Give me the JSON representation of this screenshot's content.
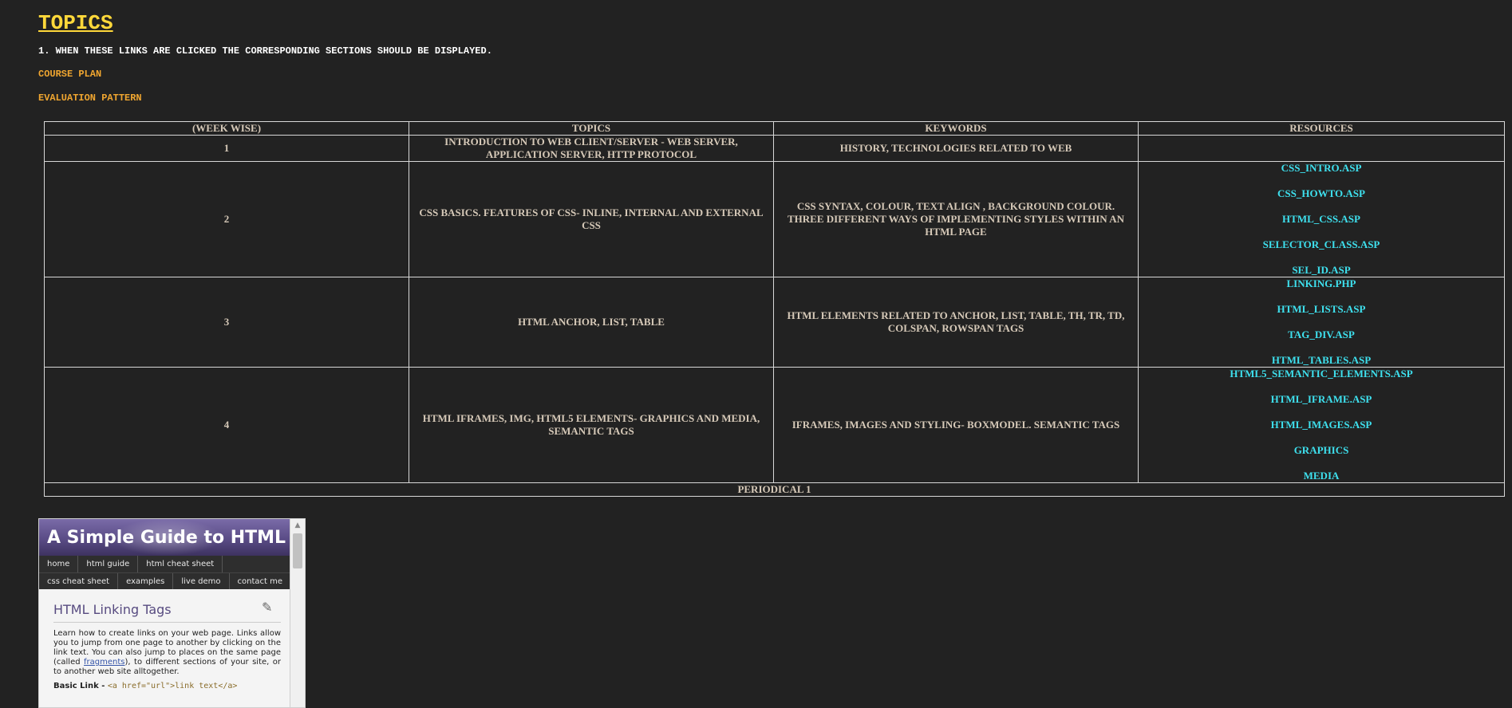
{
  "header": {
    "title": "TOPICS",
    "instruction": "1. WHEN THESE LINKS ARE CLICKED THE CORRESPONDING SECTIONS SHOULD BE DISPLAYED.",
    "links": {
      "course_plan": "COURSE PLAN",
      "evaluation_pattern": "EVALUATION PATTERN"
    }
  },
  "table": {
    "headers": [
      "(WEEK WISE)",
      "TOPICS",
      "KEYWORDS",
      "RESOURCES"
    ],
    "rows": [
      {
        "week": "1",
        "topic": "INTRODUCTION TO WEB CLIENT/SERVER - WEB SERVER, APPLICATION SERVER, HTTP PROTOCOL",
        "keywords": "HISTORY, TECHNOLOGIES RELATED TO WEB",
        "resources": []
      },
      {
        "week": "2",
        "topic": "CSS BASICS. FEATURES OF CSS- INLINE, INTERNAL AND EXTERNAL CSS",
        "keywords": "CSS SYNTAX, COLOUR, TEXT ALIGN , BACKGROUND COLOUR. THREE DIFFERENT WAYS OF IMPLEMENTING STYLES WITHIN AN HTML PAGE",
        "resources": [
          "CSS_INTRO.ASP",
          "CSS_HOWTO.ASP",
          "HTML_CSS.ASP",
          "SELECTOR_CLASS.ASP",
          "SEL_ID.ASP"
        ]
      },
      {
        "week": "3",
        "topic": "HTML ANCHOR, LIST, TABLE",
        "keywords": "HTML ELEMENTS RELATED TO ANCHOR, LIST, TABLE, TH, TR, TD, COLSPAN, ROWSPAN TAGS",
        "resources": [
          "LINKING.PHP",
          "HTML_LISTS.ASP",
          "TAG_DIV.ASP",
          "HTML_TABLES.ASP"
        ]
      },
      {
        "week": "4",
        "topic": "HTML IFRAMES, IMG, HTML5 ELEMENTS- GRAPHICS AND MEDIA, SEMANTIC TAGS",
        "keywords": "IFRAMES, IMAGES AND STYLING- BOXMODEL. SEMANTIC TAGS",
        "resources": [
          "HTML5_SEMANTIC_ELEMENTS.ASP",
          "HTML_IFRAME.ASP",
          "HTML_IMAGES.ASP",
          "GRAPHICS",
          "MEDIA"
        ]
      }
    ],
    "footer": "PERIODICAL 1"
  },
  "iframe": {
    "site_title": "A Simple Guide to HTML",
    "nav_row1": [
      "home",
      "html guide",
      "html cheat sheet"
    ],
    "nav_row2": [
      "css cheat sheet",
      "examples",
      "live demo",
      "contact me"
    ],
    "heading": "HTML Linking Tags",
    "intro_before": "Learn how to create links on your web page. Links allow you to jump from one page to another by clicking on the link text. You can also jump to places on the same page (called ",
    "intro_link": "fragments",
    "intro_after": "), to different sections of your site, or to another web site alltogether.",
    "basic_link_label": "Basic Link - ",
    "basic_link_code": "<a href=\"url\">link text</a>",
    "pencil_icon": "pencil-icon"
  },
  "colors": {
    "background": "#222222",
    "title": "#ffd83a",
    "nav_link": "#f0a630",
    "table_text": "#d6c9b8",
    "resource_link": "#3ee0ee"
  }
}
